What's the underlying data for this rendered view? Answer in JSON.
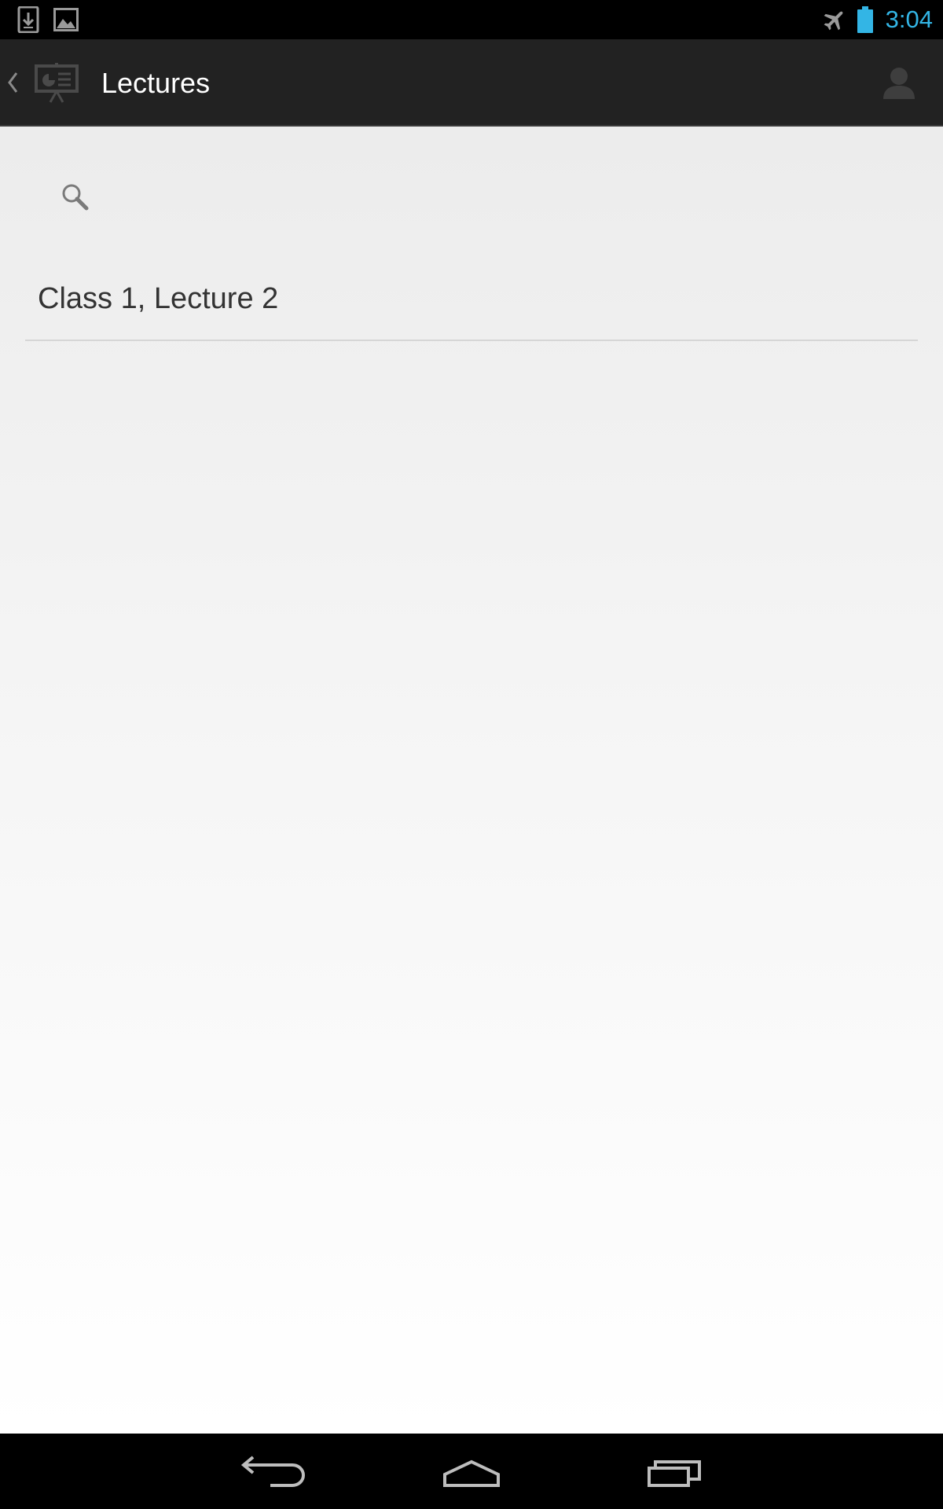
{
  "status_bar": {
    "time": "3:04",
    "icons": [
      "download-notification-icon",
      "image-notification-icon",
      "airplane-mode-icon",
      "battery-icon"
    ],
    "clock_color": "#33b5e5"
  },
  "action_bar": {
    "title": "Lectures",
    "icons": [
      "back-chevron-icon",
      "presentation-app-icon",
      "account-icon"
    ]
  },
  "content": {
    "search_icon": "search-icon",
    "items": [
      {
        "label": "Class 1, Lecture 2"
      }
    ]
  },
  "nav_bar": {
    "buttons": [
      "back-icon",
      "home-icon",
      "recent-apps-icon"
    ]
  }
}
